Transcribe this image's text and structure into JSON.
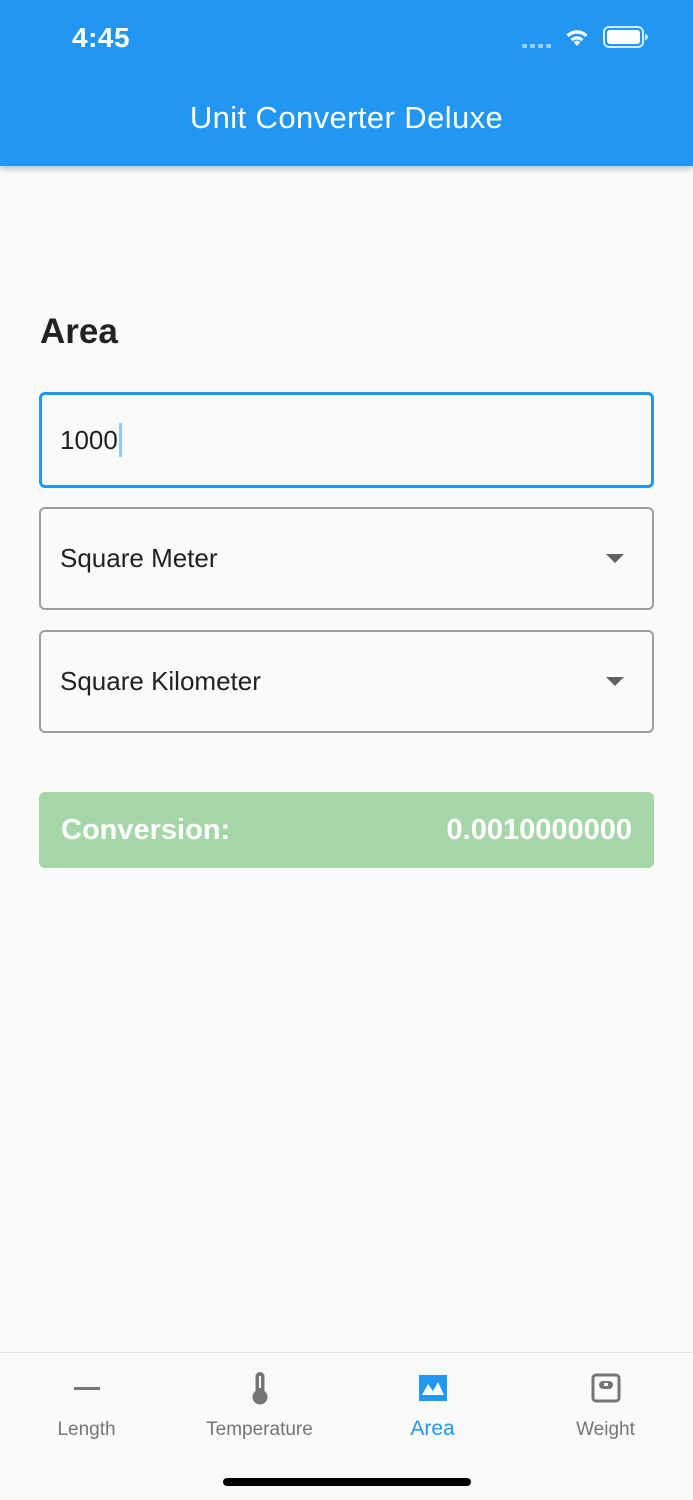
{
  "status_bar": {
    "time": "4:45"
  },
  "app_bar": {
    "title": "Unit Converter Deluxe"
  },
  "converter": {
    "category": "Area",
    "input_value": "1000",
    "from_unit": "Square Meter",
    "to_unit": "Square Kilometer",
    "conversion_label": "Conversion:",
    "conversion_value": "0.0010000000"
  },
  "bottom_nav": {
    "items": [
      {
        "label": "Length",
        "icon": "length-icon"
      },
      {
        "label": "Temperature",
        "icon": "thermometer-icon"
      },
      {
        "label": "Area",
        "icon": "area-icon",
        "active": true
      },
      {
        "label": "Weight",
        "icon": "weight-icon"
      }
    ]
  },
  "colors": {
    "primary": "#2196f3",
    "conversion_bg": "#a5d6a7",
    "inactive": "#757575"
  }
}
